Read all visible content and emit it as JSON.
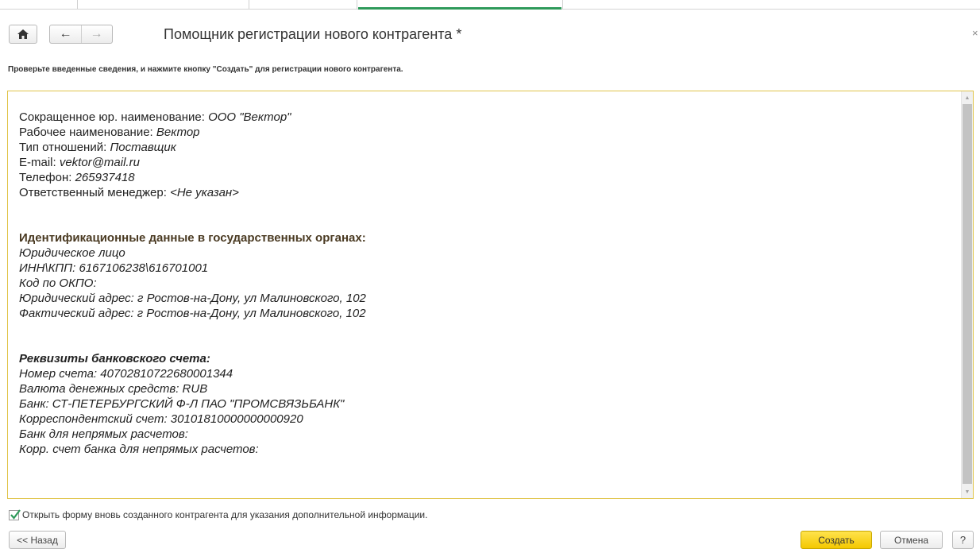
{
  "header": {
    "title": "Помощник регистрации нового контрагента *",
    "close_glyph": "×",
    "back_glyph": "←",
    "forward_glyph": "→"
  },
  "hint": "Проверьте введенные сведения, и нажмите кнопку \"Создать\"  для регистрации нового контрагента.",
  "summary": {
    "short_name_label": "Сокращенное юр. наименование: ",
    "short_name_value": "ООО \"Вектор\"",
    "work_name_label": "Рабочее наименование: ",
    "work_name_value": "Вектор",
    "relation_label": "Тип отношений: ",
    "relation_value": "Поставщик",
    "email_label": "E-mail: ",
    "email_value": "vektor@mail.ru",
    "phone_label": "Телефон: ",
    "phone_value": "265937418",
    "manager_label": "Ответственный менеджер: ",
    "manager_value": "<Не указан>",
    "id_heading": "Идентификационные данные в государственных органах:",
    "legal_entity": "Юридическое лицо",
    "inn_kpp": "ИНН\\КПП: 6167106238\\616701001",
    "okpo": "Код по ОКПО:",
    "legal_address": "Юридический адрес: г Ростов-на-Дону, ул Малиновского, 102",
    "actual_address": "Фактический адрес: г Ростов-на-Дону, ул Малиновского, 102",
    "bank_heading": "Реквизиты банковского счета:",
    "account_number": "Номер счета: 40702810722680001344",
    "currency": "Валюта денежных средств: RUB",
    "bank": "Банк: СТ-ПЕТЕРБУРГСКИЙ Ф-Л ПАО \"ПРОМСВЯЗЬБАНК\"",
    "corr_account": "Корреспондентский счет: 30101810000000000920",
    "indirect_bank": "Банк для непрямых расчетов:",
    "indirect_corr": "Корр. счет банка для непрямых расчетов:"
  },
  "checkbox": {
    "checked": true,
    "label": "Открыть форму вновь созданного контрагента для указания дополнительной информации."
  },
  "buttons": {
    "back": "<< Назад",
    "create": "Создать",
    "cancel": "Отмена",
    "help": "?"
  },
  "colors": {
    "accent_tab": "#2e9a5a",
    "create_button": "#f4c800",
    "textbox_border": "#e0c44a",
    "check_mark": "#2e9a5a"
  },
  "icons": [
    "home-icon",
    "arrow-left-icon",
    "arrow-right-icon",
    "close-icon",
    "checkmark-icon"
  ]
}
